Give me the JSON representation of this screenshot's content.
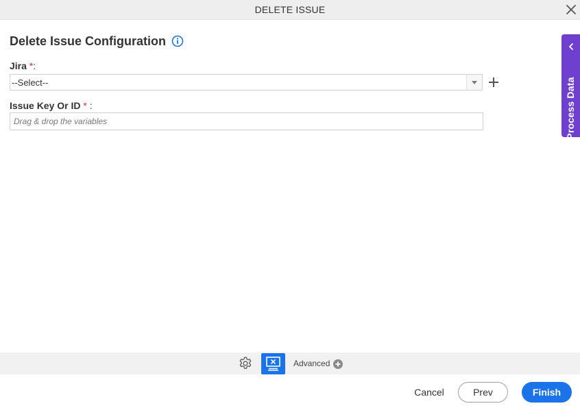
{
  "dialog": {
    "title": "DELETE ISSUE"
  },
  "page": {
    "heading": "Delete Issue Configuration"
  },
  "fields": {
    "jira": {
      "label": "Jira",
      "required_mark": "*",
      "colon": ":",
      "selected_value": "--Select--"
    },
    "issue_key": {
      "label": "Issue Key Or ID",
      "required_mark": "*",
      "colon": ":",
      "value": "",
      "placeholder": "Drag & drop the variables"
    }
  },
  "side_panel": {
    "label": "Process Data"
  },
  "toolbar": {
    "advanced_label": "Advanced"
  },
  "footer": {
    "cancel_label": "Cancel",
    "prev_label": "Prev",
    "finish_label": "Finish"
  },
  "icons": {
    "close": "close-icon",
    "info": "info-icon",
    "dropdown": "chevron-down-icon",
    "add": "plus-icon",
    "side_tab": "chevron-left-icon",
    "settings": "gear-icon",
    "monitor": "monitor-icon",
    "advanced": "plus-circle-icon"
  },
  "colors": {
    "primary": "#1a73e8",
    "side_tab": "#6f3fcf",
    "required": "#d32f2f",
    "titlebar": "#eeeeee",
    "toolbar": "#f1f1f1"
  }
}
